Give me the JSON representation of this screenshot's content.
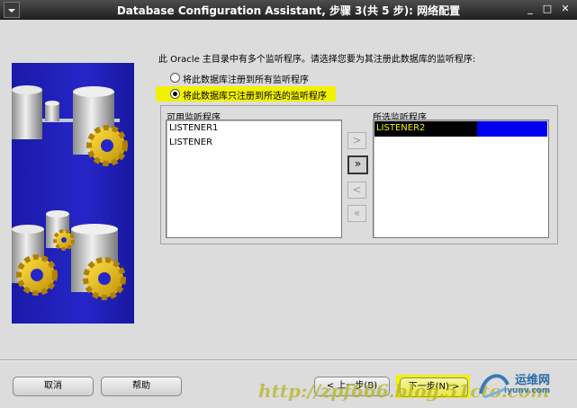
{
  "window": {
    "title": "Database Configuration Assistant, 步骤 3(共 5 步): 网络配置",
    "minimize_glyph": "_",
    "maximize_glyph": "□",
    "close_glyph": "✕"
  },
  "prompt": "此 Oracle 主目录中有多个监听程序。请选择您要为其注册此数据库的监听程序:",
  "radio_options": [
    {
      "label": "将此数据库注册到所有监听程序",
      "selected": false
    },
    {
      "label": "将此数据库只注册到所选的监听程序",
      "selected": true
    }
  ],
  "available": {
    "label": "可用监听程序",
    "items": [
      "LISTENER1",
      "LISTENER"
    ]
  },
  "selected": {
    "label": "所选监听程序",
    "items": [
      "LISTENER2"
    ]
  },
  "move_buttons": [
    {
      "glyph": ">",
      "enabled": false
    },
    {
      "glyph": "»",
      "enabled": true
    },
    {
      "glyph": "<",
      "enabled": false
    },
    {
      "glyph": "«",
      "enabled": false
    }
  ],
  "buttons": {
    "cancel": "取消",
    "help": "帮助",
    "back": "< 上一步(B)",
    "next": "下一步(N) >"
  },
  "watermark": "http://zpf666.blog.51cto.com",
  "logo": {
    "text": "运维网",
    "sub": "iyunv.com"
  },
  "colors": {
    "highlight": "#f2f200",
    "selection": "#0000f0",
    "selected_item_bg": "#000000",
    "selected_item_text": "#f2f200"
  }
}
